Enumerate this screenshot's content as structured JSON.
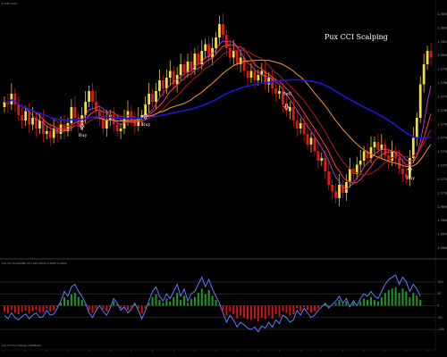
{
  "header": {
    "symbol_info": "E M30 Gold"
  },
  "main": {
    "title": "Pux CCI Scalping",
    "signals": [
      {
        "label": "Buy",
        "bar": 22,
        "dir": "up"
      },
      {
        "label": "Buy",
        "bar": 40,
        "dir": "up"
      },
      {
        "label": "Sell",
        "bar": 80,
        "dir": "down"
      },
      {
        "label": "Buy",
        "bar": 115,
        "dir": "up"
      }
    ],
    "price_ticks": [
      "1.3830",
      "1.3820",
      "1.3810",
      "1.3800",
      "1.3790",
      "1.3780",
      "1.3770",
      "1.3760",
      "1.3750",
      "1.3740",
      "1.3730",
      "1.3720",
      "1.3710",
      "1.3700",
      "1.3690",
      "1.3680",
      "1.3670",
      "1.3660"
    ]
  },
  "indicator": {
    "header": "Pux CCI SCALPING 14 (100.0000) 0.0000 0.0000",
    "levels": [
      "100",
      "50",
      "0",
      "-50",
      "-100"
    ],
    "footer": "Pux CCI Pro Sweep (ab0Nash)",
    "line_color": "#5b7cff",
    "bull_color": "#1f9a2a",
    "bear_color": "#d01515"
  },
  "colors": {
    "background": "#000000",
    "bull_candle": "#f0e03a",
    "bear_candle": "#e01818",
    "ma_fast": "#ff3a3a",
    "ma_medium": "#a01a1a",
    "ma_slow": "#e08a2a",
    "ma_long": "#1818d8",
    "ma_purple": "#c040c0"
  },
  "chart_data": {
    "type": "candlestick",
    "title": "Pux CCI Scalping",
    "series": [
      {
        "name": "close",
        "values": [
          1.3772,
          1.377,
          1.3778,
          1.377,
          1.3762,
          1.3758,
          1.3765,
          1.3755,
          1.376,
          1.3752,
          1.3758,
          1.3748,
          1.375,
          1.3745,
          1.3752,
          1.3748,
          1.3755,
          1.375,
          1.3756,
          1.3768,
          1.376,
          1.3755,
          1.3762,
          1.3772,
          1.378,
          1.3772,
          1.3765,
          1.376,
          1.3752,
          1.3758,
          1.3762,
          1.3755,
          1.375,
          1.3752,
          1.376,
          1.3765,
          1.3758,
          1.3754,
          1.376,
          1.3762,
          1.377,
          1.3778,
          1.3772,
          1.378,
          1.3788,
          1.3782,
          1.379,
          1.3795,
          1.3785,
          1.3792,
          1.38,
          1.3794,
          1.3802,
          1.3796,
          1.3808,
          1.38,
          1.381,
          1.3815,
          1.3805,
          1.3812,
          1.382,
          1.383,
          1.3822,
          1.3812,
          1.3805,
          1.381,
          1.38,
          1.3805,
          1.3795,
          1.379,
          1.3795,
          1.3788,
          1.3792,
          1.3795,
          1.3785,
          1.379,
          1.3782,
          1.3778,
          1.378,
          1.377,
          1.3765,
          1.3768,
          1.3758,
          1.3752,
          1.3756,
          1.3748,
          1.374,
          1.3745,
          1.3735,
          1.3728,
          1.373,
          1.372,
          1.371,
          1.3705,
          1.37,
          1.371,
          1.3704,
          1.3712,
          1.3722,
          1.3718,
          1.3725,
          1.3728,
          1.3735,
          1.373,
          1.3738,
          1.3742,
          1.3736,
          1.374,
          1.3732,
          1.3728,
          1.3735,
          1.373,
          1.3722,
          1.3718,
          1.3715,
          1.373,
          1.3745,
          1.376,
          1.3785,
          1.38,
          1.381,
          1.3805
        ]
      },
      {
        "name": "cci",
        "values": [
          -40,
          -55,
          -30,
          -50,
          -60,
          -45,
          -35,
          -55,
          -40,
          -30,
          -50,
          -45,
          -20,
          -40,
          -35,
          -10,
          20,
          60,
          40,
          80,
          90,
          60,
          40,
          10,
          -30,
          -50,
          -20,
          0,
          -25,
          -40,
          -10,
          30,
          10,
          -20,
          -5,
          -30,
          -15,
          10,
          -20,
          -55,
          -20,
          20,
          60,
          80,
          40,
          20,
          50,
          30,
          60,
          90,
          40,
          70,
          20,
          50,
          60,
          90,
          120,
          80,
          110,
          70,
          40,
          10,
          -30,
          -70,
          -40,
          -60,
          -90,
          -70,
          -80,
          -95,
          -100,
          -90,
          -110,
          -85,
          -95,
          -70,
          -90,
          -60,
          -75,
          -40,
          -50,
          -70,
          -60,
          -20,
          -40,
          -10,
          -30,
          -50,
          -40,
          -20,
          -5,
          10,
          -10,
          5,
          20,
          40,
          10,
          30,
          -5,
          20,
          0,
          30,
          50,
          40,
          60,
          40,
          30,
          60,
          90,
          110,
          120,
          130,
          90,
          120,
          100,
          60,
          90,
          70,
          40
        ]
      }
    ],
    "cci_levels": [
      100,
      50,
      0,
      -50,
      -100
    ]
  }
}
